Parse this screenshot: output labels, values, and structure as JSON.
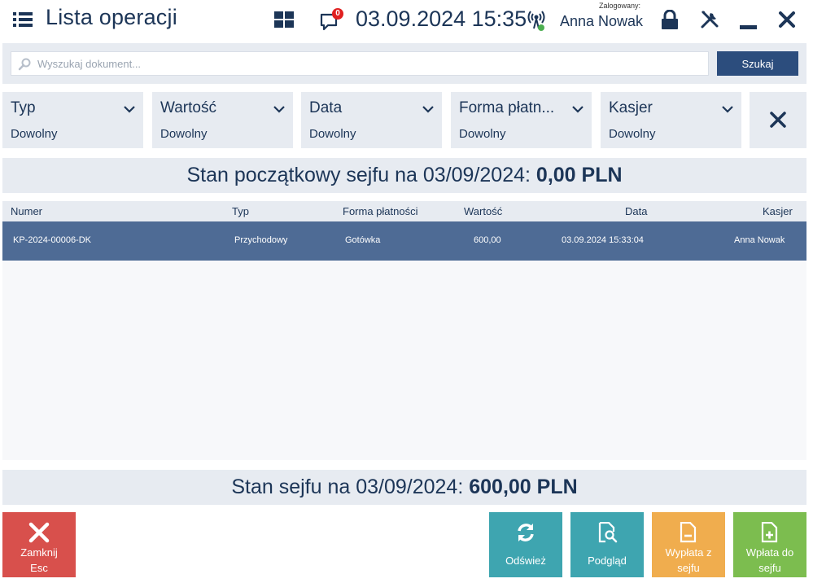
{
  "header": {
    "title": "Lista operacji",
    "notifications_count": "0",
    "datetime": "03.09.2024 15:35",
    "logged_in_label": "Zalogowany:",
    "user_name": "Anna Nowak"
  },
  "search": {
    "placeholder": "Wyszukaj dokument...",
    "button_label": "Szukaj"
  },
  "filters": [
    {
      "label": "Typ",
      "value": "Dowolny"
    },
    {
      "label": "Wartość",
      "value": "Dowolny"
    },
    {
      "label": "Data",
      "value": "Dowolny"
    },
    {
      "label": "Forma płatn...",
      "value": "Dowolny"
    },
    {
      "label": "Kasjer",
      "value": "Dowolny"
    }
  ],
  "opening_balance": {
    "label": "Stan początkowy sejfu na 03/09/2024:",
    "value": "0,00 PLN"
  },
  "table": {
    "columns": [
      "Numer",
      "Typ",
      "Forma płatności",
      "Wartość",
      "Data",
      "Kasjer"
    ],
    "rows": [
      {
        "numer": "KP-2024-00006-DK",
        "typ": "Przychodowy",
        "forma": "Gotówka",
        "wartosc": "600,00",
        "data": "03.09.2024 15:33:04",
        "kasjer": "Anna Nowak"
      }
    ]
  },
  "closing_balance": {
    "label": "Stan sejfu na 03/09/2024:",
    "value": "600,00 PLN"
  },
  "actions": {
    "close": {
      "line1": "Zamknij",
      "line2": "Esc"
    },
    "refresh": {
      "label": "Odśwież"
    },
    "preview": {
      "label": "Podgląd"
    },
    "withdraw": {
      "line1": "Wypłata z",
      "line2": "sejfu"
    },
    "deposit": {
      "line1": "Wpłata do",
      "line2": "sejfu"
    }
  },
  "colors": {
    "text_primary": "#1c3557",
    "panel_bg": "#e7ebf1",
    "selected_row": "#4e6b95",
    "search_button": "#2c4d7d",
    "close_button": "#d8504c",
    "teal_button": "#3ea5b0",
    "orange_button": "#f0ad4e",
    "green_button": "#7cbd4f",
    "badge": "#e02020"
  }
}
